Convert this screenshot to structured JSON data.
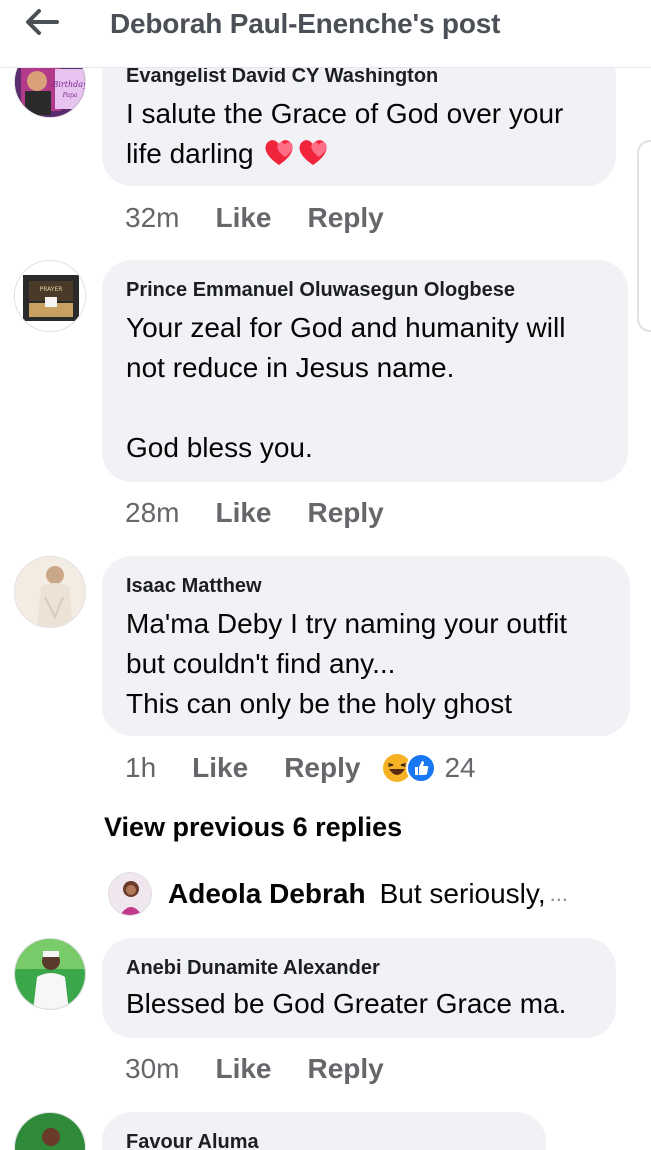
{
  "header": {
    "title": "Deborah Paul-Enenche's post",
    "back_icon": "arrow-left-icon"
  },
  "comments": [
    {
      "author": "Evangelist David CY Washington",
      "text": "I salute the Grace of God over your life darling",
      "emoji": "two-hearts-icon",
      "time": "32m",
      "like": "Like",
      "reply": "Reply"
    },
    {
      "author": "Prince Emmanuel Oluwasegun Ologbese",
      "text": "Your zeal for God and humanity will not reduce in Jesus name.\n\nGod bless you.",
      "time": "28m",
      "like": "Like",
      "reply": "Reply"
    },
    {
      "author": "Isaac Matthew",
      "text": "Ma'ma Deby I try naming your outfit but couldn't find any...\nThis can only be the holy ghost",
      "time": "1h",
      "like": "Like",
      "reply": "Reply",
      "reactions": [
        "haha-icon",
        "like-icon"
      ],
      "reaction_count": "24"
    },
    {
      "author": "Anebi Dunamite Alexander",
      "text": "Blessed be God Greater Grace ma.",
      "time": "30m",
      "like": "Like",
      "reply": "Reply"
    },
    {
      "author": "Favour Aluma"
    }
  ],
  "replies": {
    "view_previous": "View previous 6 replies",
    "preview_name": "Adeola Debrah",
    "preview_text": "But seriously,",
    "preview_ellipsis": "..."
  },
  "colors": {
    "bubble": "#f0f2f5",
    "meta": "#65676b",
    "like_blue": "#1877f2",
    "haha_yellow": "#f7b125"
  }
}
